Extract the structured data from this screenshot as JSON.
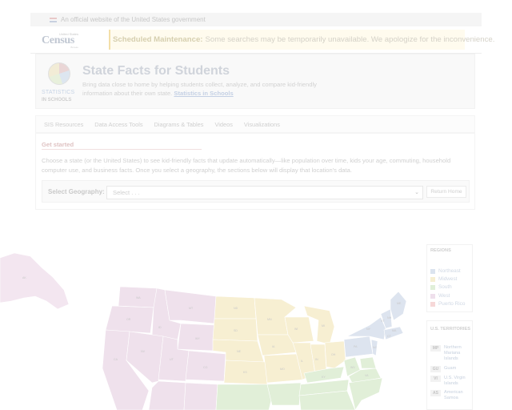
{
  "gov_banner": {
    "text": "An official website of the United States government"
  },
  "census_logo": {
    "top": "United States",
    "word": "Census",
    "bottom": "Bureau"
  },
  "maintenance": {
    "label": "Scheduled Maintenance:",
    "text": "Some searches may be temporarily unavailable. We apologize for the inconvenience."
  },
  "hero": {
    "logo_stats": "STATISTICS",
    "logo_schools": "IN SCHOOLS",
    "title": "State Facts for Students",
    "description": "Bring data close to home by helping students collect, analyze, and compare kid-friendly information about their own state.",
    "link": "Statistics in Schools"
  },
  "resources_nav": [
    "SIS Resources",
    "Data Access Tools",
    "Diagrams & Tables",
    "Videos",
    "Visualizations"
  ],
  "get_started": {
    "title": "Get started",
    "text": "Choose a state (or the United States) to see kid-friendly facts that update automatically—like population over time, kids your age, commuting, household computer use, and business facts. Once you select a geography, the sections below will display that location's data.",
    "geo_label": "Select Geography:",
    "geo_select": "Select . . .",
    "chevron": "⌄",
    "return_button": "Return Home"
  },
  "map": {
    "icon": "us-states-map",
    "states": [
      "AK",
      "WA",
      "OR",
      "ID",
      "MT",
      "WY",
      "ND",
      "SD",
      "MN",
      "WI",
      "MI",
      "IA",
      "NE",
      "IL",
      "IN",
      "OH",
      "PA",
      "NY",
      "VT",
      "NH",
      "ME",
      "MA",
      "CT",
      "NJ",
      "KY",
      "WV",
      "VA",
      "NV",
      "CA",
      "UT",
      "CO",
      "KS",
      "MO"
    ]
  },
  "regions_legend": {
    "title": "REGIONS",
    "items": [
      {
        "label": "Northeast",
        "color": "#dbe3ef"
      },
      {
        "label": "Midwest",
        "color": "#f6efd2"
      },
      {
        "label": "South",
        "color": "#e0efd8"
      },
      {
        "label": "West",
        "color": "#efe0ec"
      },
      {
        "label": "Puerto Rico",
        "color": "#f6d8d8"
      }
    ]
  },
  "territories": {
    "title": "U.S. TERRITORIES",
    "items": [
      {
        "code": "MP",
        "name": "Northern Mariana Islands"
      },
      {
        "code": "GU",
        "name": "Guam"
      },
      {
        "code": "VI",
        "name": "U.S. Virgin Islands"
      },
      {
        "code": "AS",
        "name": "American Samoa"
      }
    ]
  }
}
